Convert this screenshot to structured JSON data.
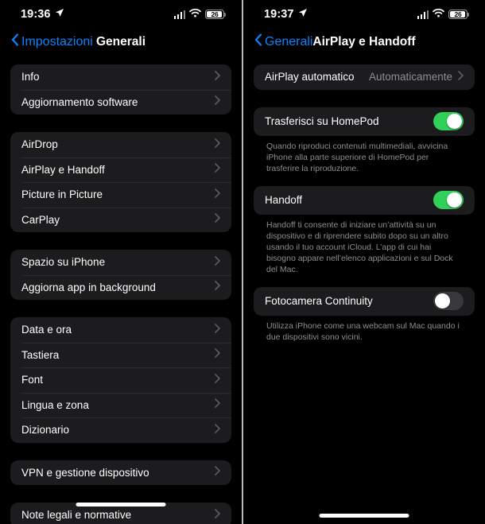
{
  "left_screen": {
    "status": {
      "time": "19:36",
      "location_icon": "location-arrow-icon",
      "signal_icon": "cellular-signal-icon",
      "wifi_icon": "wifi-icon",
      "battery_percent": "26"
    },
    "nav": {
      "back_label": "Impostazioni",
      "title": "Generali"
    },
    "sections": [
      {
        "rows": [
          {
            "label": "Info",
            "accessory": "chevron"
          },
          {
            "label": "Aggiornamento software",
            "accessory": "chevron"
          }
        ]
      },
      {
        "rows": [
          {
            "label": "AirDrop",
            "accessory": "chevron"
          },
          {
            "label": "AirPlay e Handoff",
            "accessory": "chevron"
          },
          {
            "label": "Picture in Picture",
            "accessory": "chevron"
          },
          {
            "label": "CarPlay",
            "accessory": "chevron"
          }
        ]
      },
      {
        "rows": [
          {
            "label": "Spazio su iPhone",
            "accessory": "chevron"
          },
          {
            "label": "Aggiorna app in background",
            "accessory": "chevron"
          }
        ]
      },
      {
        "rows": [
          {
            "label": "Data e ora",
            "accessory": "chevron"
          },
          {
            "label": "Tastiera",
            "accessory": "chevron"
          },
          {
            "label": "Font",
            "accessory": "chevron"
          },
          {
            "label": "Lingua e zona",
            "accessory": "chevron"
          },
          {
            "label": "Dizionario",
            "accessory": "chevron"
          }
        ]
      },
      {
        "rows": [
          {
            "label": "VPN e gestione dispositivo",
            "accessory": "chevron"
          }
        ]
      },
      {
        "rows": [
          {
            "label": "Note legali e normative",
            "accessory": "chevron"
          }
        ]
      }
    ]
  },
  "right_screen": {
    "status": {
      "time": "19:37",
      "location_icon": "location-arrow-icon",
      "signal_icon": "cellular-signal-icon",
      "wifi_icon": "wifi-icon",
      "battery_percent": "26"
    },
    "nav": {
      "back_label": "Generali",
      "title": "AirPlay e Handoff"
    },
    "airplay_auto": {
      "label": "AirPlay automatico",
      "value": "Automaticamente"
    },
    "homepod": {
      "label": "Trasferisci su HomePod",
      "state": "on",
      "footnote": "Quando riproduci contenuti multimediali, avvicina iPhone alla parte superiore di HomePod per trasferire la riproduzione."
    },
    "handoff": {
      "label": "Handoff",
      "state": "on",
      "footnote": "Handoff ti consente di iniziare un’attività su un dispositivo e di riprendere subito dopo su un altro usando il tuo account iCloud. L’app di cui hai bisogno appare nell’elenco applicazioni e sul Dock del Mac."
    },
    "continuity_camera": {
      "label": "Fotocamera Continuity",
      "state": "off",
      "footnote": "Utilizza iPhone come una webcam sul Mac quando i due dispositivi sono vicini."
    }
  },
  "colors": {
    "background": "#000000",
    "group": "#1c1c1e",
    "accent_blue": "#0a84ff",
    "toggle_on": "#30d158",
    "toggle_off": "#39393d",
    "secondary_text": "#8e8e93"
  }
}
